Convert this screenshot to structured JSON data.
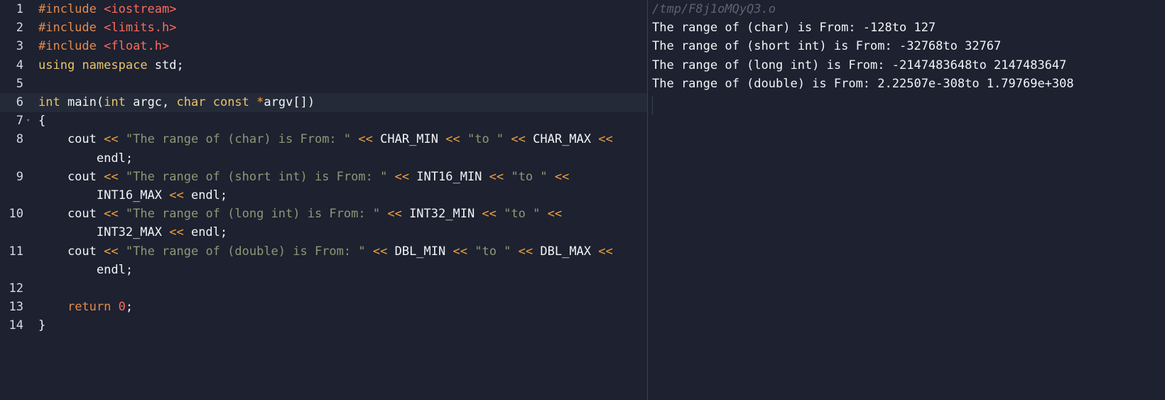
{
  "editor": {
    "lines": [
      {
        "n": "1",
        "tokens": [
          [
            "pp",
            "#include "
          ],
          [
            "inc",
            "<iostream>"
          ]
        ]
      },
      {
        "n": "2",
        "tokens": [
          [
            "pp",
            "#include "
          ],
          [
            "inc",
            "<limits.h>"
          ]
        ]
      },
      {
        "n": "3",
        "tokens": [
          [
            "pp",
            "#include "
          ],
          [
            "inc",
            "<float.h>"
          ]
        ]
      },
      {
        "n": "4",
        "tokens": [
          [
            "kw",
            "using"
          ],
          [
            "plain",
            " "
          ],
          [
            "kw",
            "namespace"
          ],
          [
            "plain",
            " std;"
          ]
        ]
      },
      {
        "n": "5",
        "tokens": []
      },
      {
        "n": "6",
        "tokens": [
          [
            "kw",
            "int"
          ],
          [
            "plain",
            " main("
          ],
          [
            "kw",
            "int"
          ],
          [
            "plain",
            " argc, "
          ],
          [
            "kw",
            "char"
          ],
          [
            "plain",
            " "
          ],
          [
            "kw",
            "const"
          ],
          [
            "plain",
            " "
          ],
          [
            "op",
            "*"
          ],
          [
            "plain",
            "argv[])"
          ]
        ]
      },
      {
        "n": "7",
        "tokens": [
          [
            "plain",
            "{"
          ]
        ]
      },
      {
        "n": "8",
        "tokens": [
          [
            "plain",
            "    cout "
          ],
          [
            "op",
            "<<"
          ],
          [
            "plain",
            " "
          ],
          [
            "str",
            "\"The range of (char) is From: \""
          ],
          [
            "plain",
            " "
          ],
          [
            "op",
            "<<"
          ],
          [
            "plain",
            " CHAR_MIN "
          ],
          [
            "op",
            "<<"
          ],
          [
            "plain",
            " "
          ],
          [
            "str",
            "\"to \""
          ],
          [
            "plain",
            " "
          ],
          [
            "op",
            "<<"
          ],
          [
            "plain",
            " CHAR_MAX "
          ],
          [
            "op",
            "<<"
          ]
        ]
      },
      {
        "n": "",
        "tokens": [
          [
            "plain",
            "        endl;"
          ]
        ]
      },
      {
        "n": "9",
        "tokens": [
          [
            "plain",
            "    cout "
          ],
          [
            "op",
            "<<"
          ],
          [
            "plain",
            " "
          ],
          [
            "str",
            "\"The range of (short int) is From: \""
          ],
          [
            "plain",
            " "
          ],
          [
            "op",
            "<<"
          ],
          [
            "plain",
            " INT16_MIN "
          ],
          [
            "op",
            "<<"
          ],
          [
            "plain",
            " "
          ],
          [
            "str",
            "\"to \""
          ],
          [
            "plain",
            " "
          ],
          [
            "op",
            "<<"
          ]
        ]
      },
      {
        "n": "",
        "tokens": [
          [
            "plain",
            "        INT16_MAX "
          ],
          [
            "op",
            "<<"
          ],
          [
            "plain",
            " endl;"
          ]
        ]
      },
      {
        "n": "10",
        "tokens": [
          [
            "plain",
            "    cout "
          ],
          [
            "op",
            "<<"
          ],
          [
            "plain",
            " "
          ],
          [
            "str",
            "\"The range of (long int) is From: \""
          ],
          [
            "plain",
            " "
          ],
          [
            "op",
            "<<"
          ],
          [
            "plain",
            " INT32_MIN "
          ],
          [
            "op",
            "<<"
          ],
          [
            "plain",
            " "
          ],
          [
            "str",
            "\"to \""
          ],
          [
            "plain",
            " "
          ],
          [
            "op",
            "<<"
          ]
        ]
      },
      {
        "n": "",
        "tokens": [
          [
            "plain",
            "        INT32_MAX "
          ],
          [
            "op",
            "<<"
          ],
          [
            "plain",
            " endl;"
          ]
        ]
      },
      {
        "n": "11",
        "tokens": [
          [
            "plain",
            "    cout "
          ],
          [
            "op",
            "<<"
          ],
          [
            "plain",
            " "
          ],
          [
            "str",
            "\"The range of (double) is From: \""
          ],
          [
            "plain",
            " "
          ],
          [
            "op",
            "<<"
          ],
          [
            "plain",
            " DBL_MIN "
          ],
          [
            "op",
            "<<"
          ],
          [
            "plain",
            " "
          ],
          [
            "str",
            "\"to \""
          ],
          [
            "plain",
            " "
          ],
          [
            "op",
            "<<"
          ],
          [
            "plain",
            " DBL_MAX "
          ],
          [
            "op",
            "<<"
          ]
        ]
      },
      {
        "n": "",
        "tokens": [
          [
            "plain",
            "        endl;"
          ]
        ]
      },
      {
        "n": "12",
        "tokens": []
      },
      {
        "n": "13",
        "tokens": [
          [
            "plain",
            "    "
          ],
          [
            "pp",
            "return"
          ],
          [
            "plain",
            " "
          ],
          [
            "num",
            "0"
          ],
          [
            "plain",
            ";"
          ]
        ]
      },
      {
        "n": "14",
        "tokens": [
          [
            "plain",
            "}"
          ]
        ]
      }
    ],
    "active_line": 5,
    "fold_line": 6
  },
  "output": {
    "path": "/tmp/F8j1oMQyQ3.o",
    "lines": [
      "The range of (char) is From: -128to 127",
      "The range of (short int) is From: -32768to 32767",
      "The range of (long int) is From: -2147483648to 2147483647",
      "The range of (double) is From: 2.22507e-308to 1.79769e+308"
    ]
  }
}
